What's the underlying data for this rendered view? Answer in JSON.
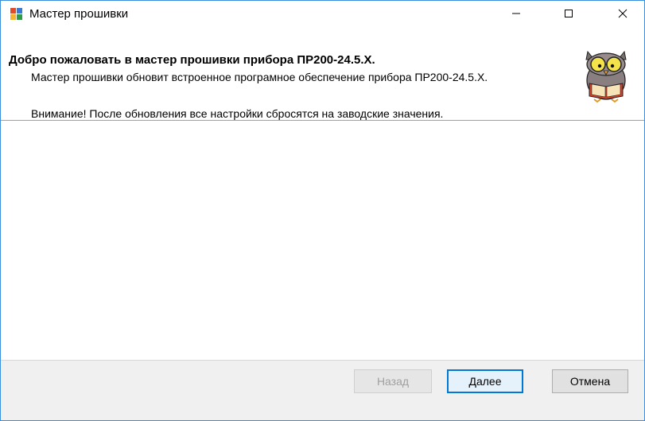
{
  "window": {
    "title": "Мастер прошивки",
    "app_icon": "wizard-app-icon"
  },
  "header": {
    "title": "Добро пожаловать в мастер прошивки прибора ПР200-24.5.X.",
    "description": "Мастер прошивки обновит встроенное програмное обеспечение прибора ПР200-24.5.X.",
    "warning": "Внимание! После обновления все настройки сбросятся на заводские значения.",
    "mascot": "owl-reading-book-icon"
  },
  "footer": {
    "back_label": "Назад",
    "next_label": "Далее",
    "cancel_label": "Отмена"
  },
  "colors": {
    "accent": "#0078d7",
    "window_border": "#3c8fdc",
    "footer_bg": "#f0f0f0",
    "disabled_text": "#a0a0a0"
  }
}
